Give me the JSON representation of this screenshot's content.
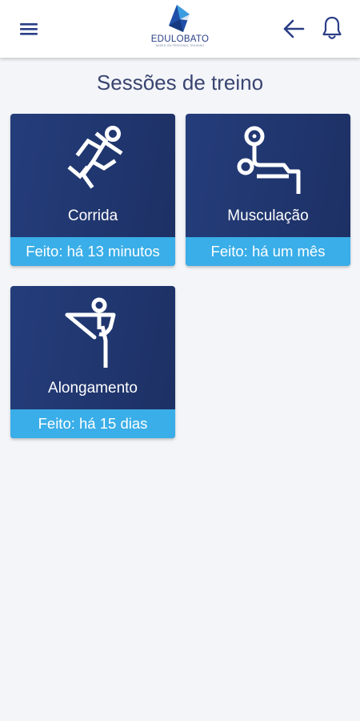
{
  "header": {
    "menu_icon": "hamburger-menu-icon",
    "back_icon": "arrow-left-icon",
    "notifications_icon": "bell-icon",
    "logo": {
      "name": "EDULOBATO",
      "tagline": "BASED ON PERSONAL TRAINING"
    }
  },
  "page": {
    "title": "Sessões de treino"
  },
  "sessions": [
    {
      "icon": "running-person-icon",
      "label": "Corrida",
      "status": "Feito: há 13 minutos"
    },
    {
      "icon": "weightlifting-bench-icon",
      "label": "Musculação",
      "status": "Feito: há um mês"
    },
    {
      "icon": "stretching-person-icon",
      "label": "Alongamento",
      "status": "Feito: há 15 dias"
    }
  ],
  "colors": {
    "card_background": "#1f346f",
    "card_status": "#3aaee8",
    "title_text": "#3a4470",
    "header_icons": "#2a3e86",
    "background": "#f3f5f9"
  }
}
